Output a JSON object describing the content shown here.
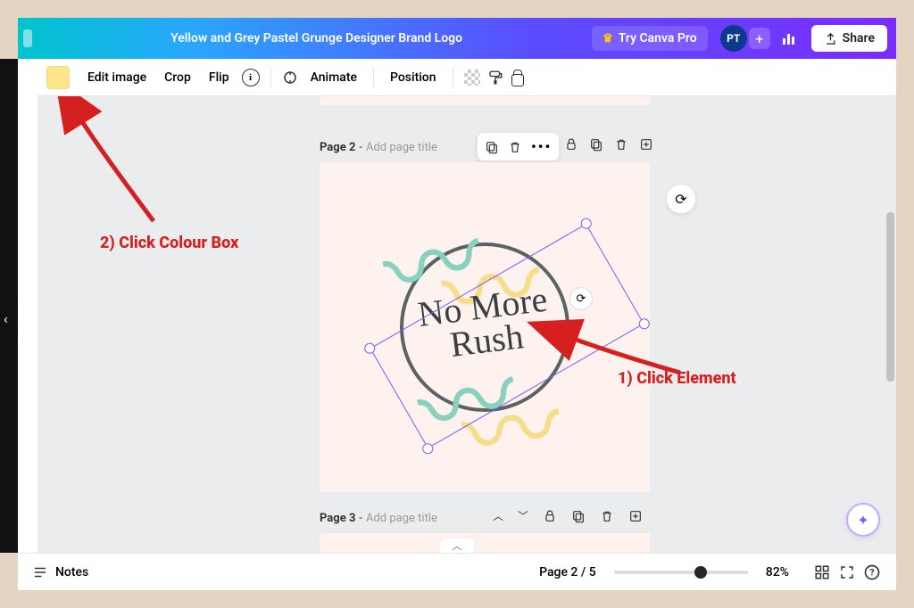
{
  "header": {
    "doc_title": "Yellow and Grey Pastel Grunge Designer Brand Logo",
    "try_pro": "Try Canva Pro",
    "avatar_initials": "PT",
    "share_label": "Share"
  },
  "toolbar": {
    "color_swatch": "#ffe58a",
    "edit_image": "Edit image",
    "crop": "Crop",
    "flip": "Flip",
    "animate": "Animate",
    "position": "Position"
  },
  "pages": {
    "page2": {
      "label": "Page 2",
      "placeholder": "Add page title"
    },
    "page3": {
      "label": "Page 3",
      "placeholder": "Add page title"
    }
  },
  "logo": {
    "line1": "No More",
    "line2": "Rush"
  },
  "annotations": {
    "step1": "1) Click Element",
    "step2": "2) Click Colour Box"
  },
  "footer": {
    "notes": "Notes",
    "page_indicator": "Page 2 / 5",
    "zoom_pct": "82%",
    "slider_pos": 0.6
  }
}
